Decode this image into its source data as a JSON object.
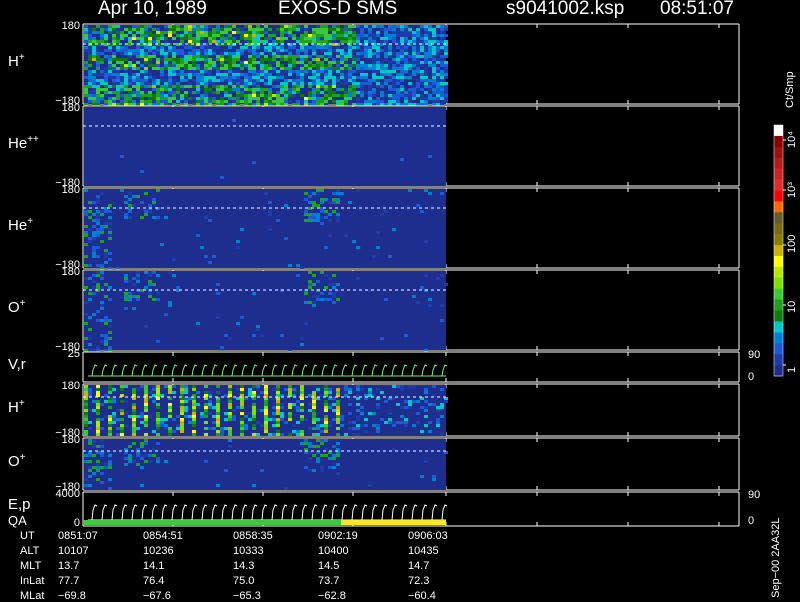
{
  "header": {
    "date": "Apr 10, 1989",
    "instrument": "EXOS-D SMS",
    "filename": "s9041002.ksp",
    "time": "08:51:07"
  },
  "colors": {
    "background": "#000000",
    "panel_fill": "#1e2e8e",
    "axis": "#ffffff",
    "dashed_line": "#ffffff",
    "trace_green": "#7cf07c",
    "trace_white": "#ffffff",
    "qa_green": "#3ec93e",
    "qa_yellow": "#f7e92a"
  },
  "panels": [
    {
      "id": "h-plus",
      "label": "H",
      "superscript": "+",
      "ymax": "180",
      "ymin": "−180",
      "activity": "high"
    },
    {
      "id": "he-plusplus",
      "label": "He",
      "superscript": "++",
      "ymax": "180",
      "ymin": "−180",
      "activity": "none"
    },
    {
      "id": "he-plus",
      "label": "He",
      "superscript": "+",
      "ymax": "180",
      "ymin": "−180",
      "activity": "low"
    },
    {
      "id": "o-plus",
      "label": "O",
      "superscript": "+",
      "ymax": "180",
      "ymin": "−180",
      "activity": "low"
    },
    {
      "id": "vr",
      "label": "V,r",
      "superscript": "",
      "ymax": "25",
      "ymin": "",
      "right_top": "90",
      "right_bottom": "0",
      "activity": "trace"
    },
    {
      "id": "h-plus-2",
      "label": "H",
      "superscript": "+",
      "ymax": "180",
      "ymin": "−180",
      "activity": "medium"
    },
    {
      "id": "o-plus-2",
      "label": "O",
      "superscript": "+",
      "ymax": "180",
      "ymin": "−180",
      "activity": "low"
    },
    {
      "id": "ep-qa",
      "label": "E,p",
      "label2": "QA",
      "superscript": "",
      "ymax": "4000",
      "ymin": "0",
      "right_top": "90",
      "right_bottom": "0",
      "activity": "trace"
    }
  ],
  "colorbar": {
    "unit_label": "Ct/Smp",
    "tick_labels": [
      "10⁴",
      "10³",
      "100",
      "10",
      "1"
    ],
    "colors": [
      "#ffffff",
      "#8b0000",
      "#a01010",
      "#b51c1c",
      "#cc2222",
      "#e02c2c",
      "#ff0000",
      "#ff6a00",
      "#6b5a2a",
      "#7a6a14",
      "#8a7a0c",
      "#c8b400",
      "#ffff00",
      "#b6e800",
      "#7ee000",
      "#38c838",
      "#20a020",
      "#107a10",
      "#00c8c8",
      "#0080d0",
      "#1e5ad8",
      "#1e3ca8",
      "#1e2e8e"
    ]
  },
  "ephemeris": {
    "row_labels": [
      "UT",
      "ALT",
      "MLT",
      "InLat",
      "MLat"
    ],
    "columns": [
      {
        "UT": "0851:07",
        "ALT": "10107",
        "MLT": "13.7",
        "InLat": "77.7",
        "MLat": "−69.8"
      },
      {
        "UT": "0854:51",
        "ALT": "10236",
        "MLT": "14.1",
        "InLat": "76.4",
        "MLat": "−67.6"
      },
      {
        "UT": "0858:35",
        "ALT": "10333",
        "MLT": "14.3",
        "InLat": "75.0",
        "MLat": "−65.3"
      },
      {
        "UT": "0902:19",
        "ALT": "10400",
        "MLT": "14.5",
        "InLat": "73.7",
        "MLat": "−62.8"
      },
      {
        "UT": "0906:03",
        "ALT": "10435",
        "MLT": "14.7",
        "InLat": "72.3",
        "MLat": "−60.4"
      }
    ]
  },
  "footer": {
    "version": "Sep−00 2AA32L"
  }
}
